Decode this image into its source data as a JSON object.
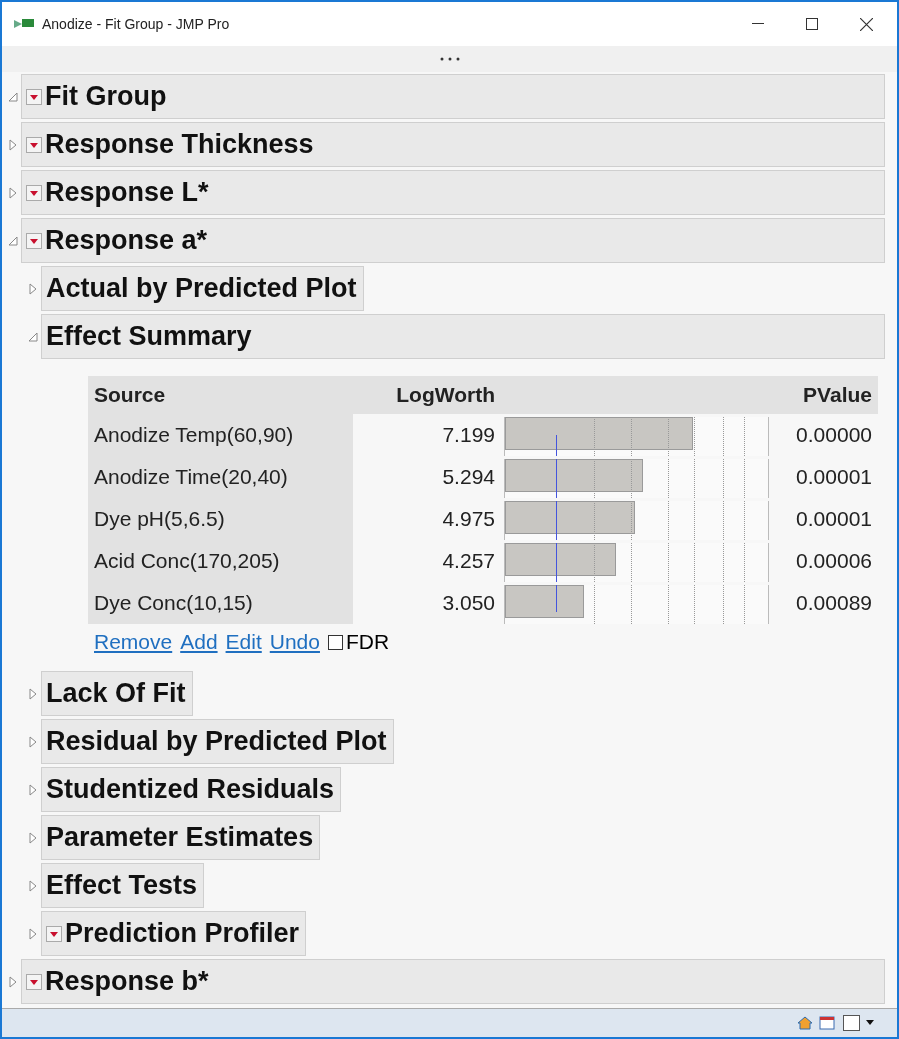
{
  "window": {
    "title": "Anodize - Fit Group - JMP Pro"
  },
  "outline": {
    "title": "Fit Group",
    "expanded": true,
    "menu": true,
    "children": [
      {
        "title": "Response Thickness",
        "expanded": false,
        "menu": true
      },
      {
        "title": "Response L*",
        "expanded": false,
        "menu": true
      },
      {
        "title": "Response a*",
        "expanded": true,
        "menu": true,
        "children": [
          {
            "title": "Actual by Predicted Plot",
            "expanded": false,
            "menu": false
          },
          {
            "title": "Effect Summary",
            "expanded": true,
            "menu": false,
            "effect_summary": {
              "columns": [
                "Source",
                "LogWorth",
                "PValue"
              ],
              "rows": [
                {
                  "source": "Anodize Temp(60,90)",
                  "logworth": "7.199",
                  "level": 0.713,
                  "pvalue": "0.00000"
                },
                {
                  "source": "Anodize Time(20,40)",
                  "logworth": "5.294",
                  "level": 0.524,
                  "pvalue": "0.00001"
                },
                {
                  "source": "Dye pH(5,6.5)",
                  "logworth": "4.975",
                  "level": 0.493,
                  "pvalue": "0.00001"
                },
                {
                  "source": "Acid Conc(170,205)",
                  "logworth": "4.257",
                  "level": 0.421,
                  "pvalue": "0.00006"
                },
                {
                  "source": "Dye Conc(10,15)",
                  "logworth": "3.050",
                  "level": 0.302,
                  "pvalue": "0.00089"
                }
              ],
              "links": [
                "Remove",
                "Add",
                "Edit",
                "Undo"
              ],
              "fdr": {
                "label": "FDR",
                "checked": false
              }
            }
          },
          {
            "title": "Lack Of Fit",
            "expanded": false,
            "menu": false
          },
          {
            "title": "Residual by Predicted Plot",
            "expanded": false,
            "menu": false
          },
          {
            "title": "Studentized Residuals",
            "expanded": false,
            "menu": false
          },
          {
            "title": "Parameter Estimates",
            "expanded": false,
            "menu": false
          },
          {
            "title": "Effect Tests",
            "expanded": false,
            "menu": false
          },
          {
            "title": "Prediction Profiler",
            "expanded": false,
            "menu": true
          }
        ]
      },
      {
        "title": "Response b*",
        "expanded": false,
        "menu": true
      }
    ]
  }
}
